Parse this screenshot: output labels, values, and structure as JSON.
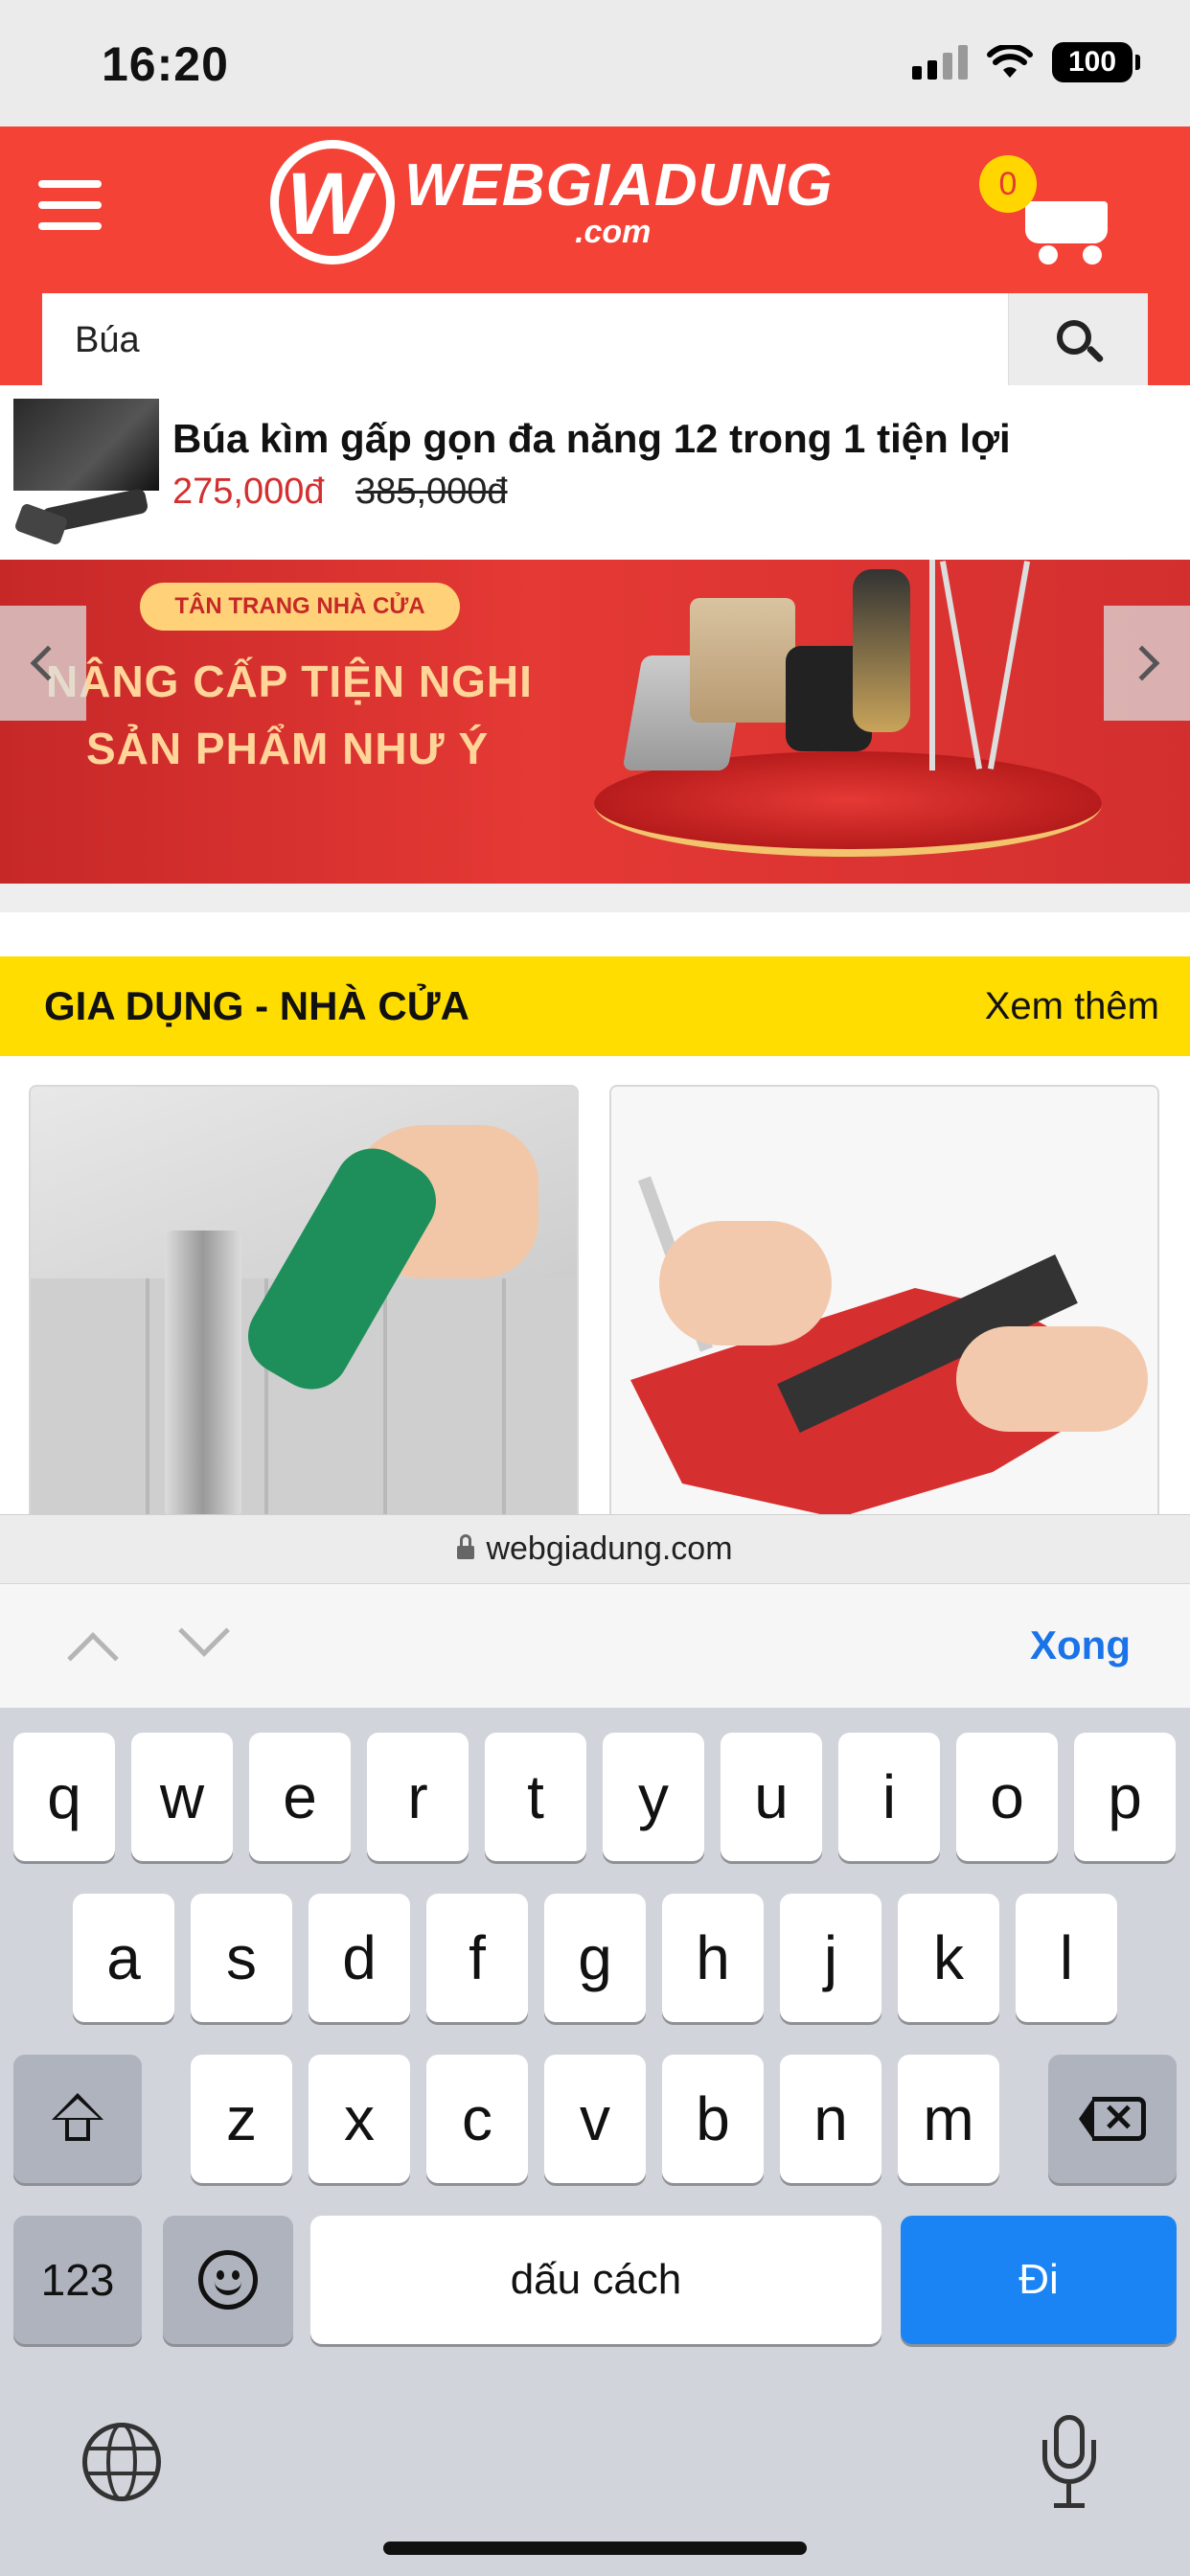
{
  "status_bar": {
    "time": "16:20",
    "battery": "100"
  },
  "header": {
    "logo_name": "WEBGIADUNG",
    "logo_sub": ".com",
    "logo_mark": "W",
    "cart_count": "0",
    "search": {
      "value": "Búa",
      "placeholder": ""
    },
    "icons": {
      "menu": "hamburger-menu-icon",
      "cart": "shopping-cart-icon",
      "search": "search-icon"
    }
  },
  "suggestion": {
    "title": "Búa kìm gấp gọn đa năng 12 trong 1 tiện lợi",
    "price_new": "275,000đ",
    "price_old": "385,000đ"
  },
  "banner": {
    "tag": "TÂN TRANG NHÀ CỬA",
    "line1": "NÂNG CẤP TIỆN NGHI",
    "line2": "SẢN PHẨM NHƯ Ý"
  },
  "section": {
    "title": "GIA DỤNG - NHÀ CỬA",
    "more": "Xem thêm"
  },
  "browser": {
    "url": "webgiadung.com"
  },
  "keyboard_accessory": {
    "done": "Xong"
  },
  "keyboard": {
    "row1": [
      "q",
      "w",
      "e",
      "r",
      "t",
      "y",
      "u",
      "i",
      "o",
      "p"
    ],
    "row2": [
      "a",
      "s",
      "d",
      "f",
      "g",
      "h",
      "j",
      "k",
      "l"
    ],
    "row3": [
      "z",
      "x",
      "c",
      "v",
      "b",
      "n",
      "m"
    ],
    "numbers": "123",
    "space": "dấu cách",
    "go": "Đi"
  },
  "colors": {
    "header_red": "#f44336",
    "section_yellow": "#ffdd00",
    "price_red": "#d32f2f",
    "go_blue": "#1a84f5",
    "done_blue": "#1a73e8"
  }
}
